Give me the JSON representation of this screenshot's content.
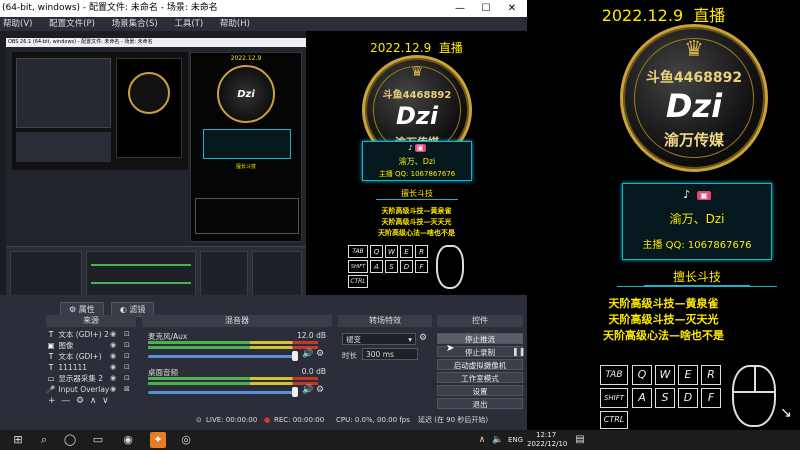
{
  "window": {
    "title": "(64-bit, windows) - 配置文件: 未命名 - 场景: 未命名",
    "minimize": "—",
    "maximize": "☐",
    "close": "✕"
  },
  "menu": {
    "items": [
      "帮助(V)",
      "配置文件(P)",
      "场景集合(S)",
      "工具(T)",
      "帮助(H)"
    ]
  },
  "nested": {
    "title_bar": "OBS 26.1 (64-bit, windows) - 配置文件: 未命名 - 场景: 未命名"
  },
  "overlay": {
    "date": "2022.12.9",
    "live": "直播",
    "medal": {
      "number": "斗鱼4468892",
      "name": "Dzi",
      "company": "渝万传媒"
    },
    "info": {
      "name": "渝万、Dzi",
      "qq": "主播 QQ: 1067867676"
    },
    "skills_title": "擅长斗技",
    "skills": [
      "天阶高级斗技—黄泉雀",
      "天阶高级斗技—灭天光",
      "天阶高级心法—啥也不是"
    ],
    "keys": {
      "tab": "TAB",
      "shift": "SHIFT",
      "ctrl": "CTRL",
      "row1": [
        "Q",
        "W",
        "E",
        "R"
      ],
      "row2": [
        "A",
        "S",
        "D",
        "F"
      ]
    }
  },
  "docks": {
    "tabs": [
      "属性",
      "滤镜"
    ],
    "sources_header": "来源",
    "mixer_header": "混音器",
    "transition_header": "转场特效",
    "controls_header": "控件",
    "sources": [
      {
        "icon": "T",
        "label": "文本 (GDI+) 2"
      },
      {
        "icon": "▣",
        "label": "图像"
      },
      {
        "icon": "T",
        "label": "文本 (GDI+)"
      },
      {
        "icon": "T",
        "label": "111111"
      },
      {
        "icon": "▭",
        "label": "显示器采集 2"
      },
      {
        "icon": "🎤",
        "label": "Input Overlay"
      }
    ],
    "mixer": [
      {
        "label": "麦克风/Aux",
        "db": "12.0 dB"
      },
      {
        "label": "桌面音频",
        "db": "0.0 dB"
      }
    ],
    "transition": {
      "type": "褪变",
      "duration_label": "时长",
      "duration": "300 ms"
    },
    "controls": [
      "停止推流",
      "停止录制",
      "启动虚拟摄像机",
      "工作室模式",
      "设置",
      "退出"
    ],
    "add": "+",
    "remove": "—",
    "settings": "⚙",
    "up": "∧",
    "down": "∨"
  },
  "status": {
    "live": "LIVE: 00:00:00",
    "rec": "REC: 00:00:00",
    "cpu": "CPU: 0.0%, 00.00 fps",
    "delay": "延迟 (在 90 秒后开始)"
  },
  "taskbar": {
    "lang": "ENG",
    "time": "12:17",
    "date": "2022/12/10"
  },
  "colors": {
    "accent_yellow": "#ffea00",
    "accent_cyan": "#1bb3c9",
    "gold": "#c9a23a",
    "obs_bg": "#2b2e38"
  }
}
